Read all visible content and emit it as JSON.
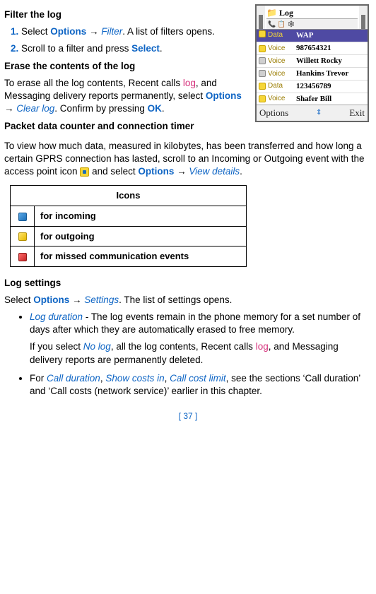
{
  "headings": {
    "filter": "Filter the log",
    "erase": "Erase the contents of the log",
    "packet": "Packet data counter and connection timer",
    "log_settings": "Log settings"
  },
  "steps": {
    "s1a": "Select ",
    "s1_opt": "Options",
    "s1_arrow": " → ",
    "s1_filter": "Filter",
    "s1b": ". A list of filters opens.",
    "s2a": "Scroll to a filter and press ",
    "s2_sel": "Select",
    "s2b": "."
  },
  "erase": {
    "p1a": "To erase all the log contents, Recent calls ",
    "p1_log": "log",
    "p1b": ", and Messaging delivery reports permanently, select ",
    "p1_opt": "Options",
    "p1_arrow": " → ",
    "p1_clear": "Clear log",
    "p1c": ". Confirm by pressing ",
    "p1_ok": "OK",
    "p1d": "."
  },
  "packet": {
    "p1a": "To view how much data, measured in kilobytes, has been transferred and how long a certain GPRS connection has lasted, scroll to an Incoming or Outgoing event with the access point icon ",
    "p1b": " and select ",
    "p1_opt": "Options",
    "p1_arrow": " → ",
    "p1_view": "View details",
    "p1c": "."
  },
  "icons_table": {
    "header": "Icons",
    "rows": [
      {
        "label": "for incoming"
      },
      {
        "label": "for outgoing"
      },
      {
        "label": "for missed communication events"
      }
    ]
  },
  "log_settings": {
    "intro_a": "Select ",
    "intro_opt": "Options",
    "intro_arrow": " → ",
    "intro_set": "Settings",
    "intro_b": ". The list of settings opens.",
    "b1_term": "Log duration",
    "b1_a": " - The log events remain in the phone memory for a set number of days after which they are automatically erased to free memory.",
    "b1_p2a": "If you select ",
    "b1_nolog": "No log",
    "b1_p2b": ", all the log contents, Recent calls ",
    "b1_log": "log",
    "b1_p2c": ", and Messaging delivery reports are permanently deleted.",
    "b2_a": "For ",
    "b2_t1": "Call duration",
    "b2_s1": ", ",
    "b2_t2": "Show costs in",
    "b2_s2": ", ",
    "b2_t3": "Call cost limit",
    "b2_b": ", see the sections ‘Call duration’ and ‘Call costs (network service)’ earlier in this chapter."
  },
  "figure": {
    "title": "Log",
    "statusbar": "📞    📋  🕸",
    "sel_lab": "Data",
    "sel_val": "WAP",
    "rows": [
      {
        "lab": "Voice",
        "val": "987654321",
        "g": false
      },
      {
        "lab": "Voice",
        "val": "Willett Rocky",
        "g": true
      },
      {
        "lab": "Voice",
        "val": "Hankins Trevor",
        "g": true
      },
      {
        "lab": "Data",
        "val": "123456789",
        "g": false
      },
      {
        "lab": "Voice",
        "val": "Shafer Bill",
        "g": false
      }
    ],
    "soft_left": "Options",
    "soft_mid": "⇕",
    "soft_right": "Exit"
  },
  "page_number": "[ 37 ]"
}
